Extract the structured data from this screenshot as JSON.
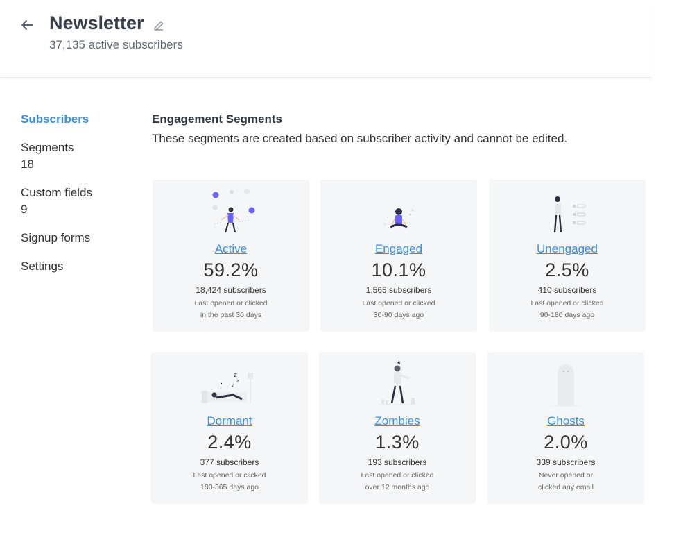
{
  "header": {
    "title": "Newsletter",
    "subtitle": "37,135 active subscribers"
  },
  "sidebar": {
    "items": [
      {
        "label": "Subscribers",
        "count": null,
        "active": true
      },
      {
        "label": "Segments",
        "count": "18"
      },
      {
        "label": "Custom fields",
        "count": "9"
      },
      {
        "label": "Signup forms",
        "count": null
      },
      {
        "label": "Settings",
        "count": null
      }
    ]
  },
  "main": {
    "title": "Engagement Segments",
    "description": "These segments are created based on subscriber activity and cannot be edited."
  },
  "segments": [
    {
      "name": "Active",
      "percent": "59.2%",
      "subscribers": "18,424 subscribers",
      "desc1": "Last opened or clicked",
      "desc2": "in the past 30 days",
      "icon": "juggler-illustration-icon"
    },
    {
      "name": "Engaged",
      "percent": "10.1%",
      "subscribers": "1,565 subscribers",
      "desc1": "Last opened or clicked",
      "desc2": "30-90 days ago",
      "icon": "meditating-person-illustration-icon"
    },
    {
      "name": "Unengaged",
      "percent": "2.5%",
      "subscribers": "410 subscribers",
      "desc1": "Last opened or clicked",
      "desc2": "90-180 days ago",
      "icon": "checklist-person-illustration-icon"
    },
    {
      "name": "Dormant",
      "percent": "2.4%",
      "subscribers": "377 subscribers",
      "desc1": "Last opened or clicked",
      "desc2": "180-365 days ago",
      "icon": "sleeping-person-illustration-icon"
    },
    {
      "name": "Zombies",
      "percent": "1.3%",
      "subscribers": "193 subscribers",
      "desc1": "Last opened or clicked",
      "desc2": "over 12 months ago",
      "icon": "zombie-illustration-icon"
    },
    {
      "name": "Ghosts",
      "percent": "2.0%",
      "subscribers": "339 subscribers",
      "desc1": "Never opened or",
      "desc2": "clicked any email",
      "icon": "ghost-illustration-icon"
    }
  ],
  "colors": {
    "accent": "#3b8ee0",
    "card_bg": "#f4f6f8",
    "illustration_accent": "#6c63ff"
  }
}
